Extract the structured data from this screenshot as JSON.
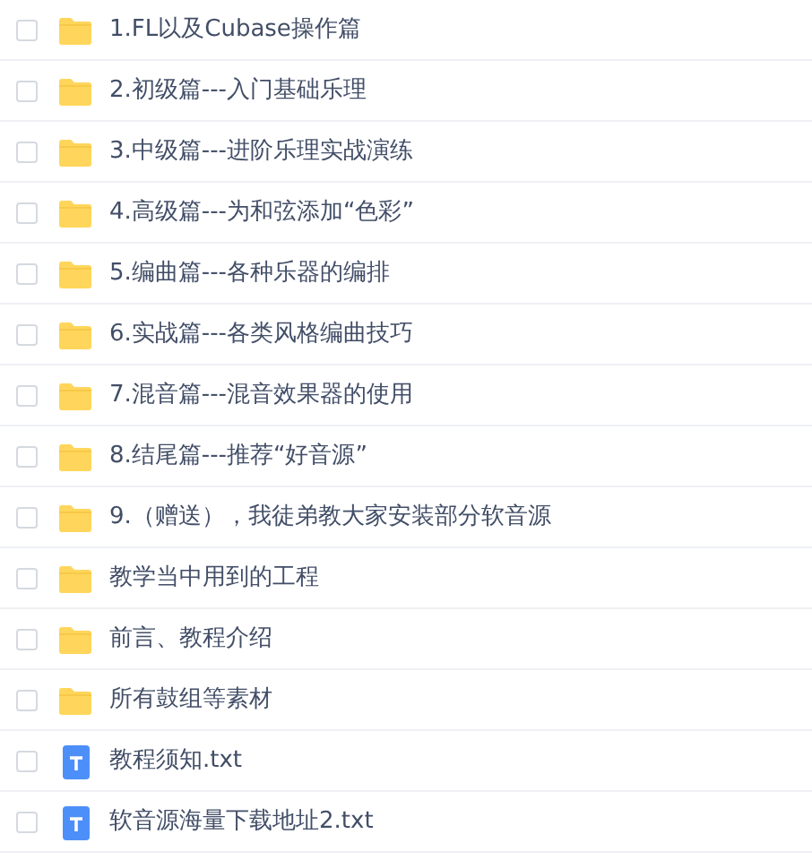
{
  "files": [
    {
      "name": "1.FL以及Cubase操作篇",
      "kind": "folder",
      "checked": false
    },
    {
      "name": "2.初级篇---入门基础乐理",
      "kind": "folder",
      "checked": false
    },
    {
      "name": "3.中级篇---进阶乐理实战演练",
      "kind": "folder",
      "checked": false
    },
    {
      "name": "4.高级篇---为和弦添加“色彩”",
      "kind": "folder",
      "checked": false
    },
    {
      "name": "5.编曲篇---各种乐器的编排",
      "kind": "folder",
      "checked": false
    },
    {
      "name": "6.实战篇---各类风格编曲技巧",
      "kind": "folder",
      "checked": false
    },
    {
      "name": "7.混音篇---混音效果器的使用",
      "kind": "folder",
      "checked": false
    },
    {
      "name": "8.结尾篇---推荐“好音源”",
      "kind": "folder",
      "checked": false
    },
    {
      "name": "9.（赠送），我徒弟教大家安装部分软音源",
      "kind": "folder",
      "checked": false
    },
    {
      "name": "教学当中用到的工程",
      "kind": "folder",
      "checked": false
    },
    {
      "name": "前言、教程介绍",
      "kind": "folder",
      "checked": false
    },
    {
      "name": "所有鼓组等素材",
      "kind": "folder",
      "checked": false
    },
    {
      "name": "教程须知.txt",
      "kind": "text-file",
      "checked": false
    },
    {
      "name": "软音源海量下载地址2.txt",
      "kind": "text-file",
      "checked": false
    }
  ]
}
